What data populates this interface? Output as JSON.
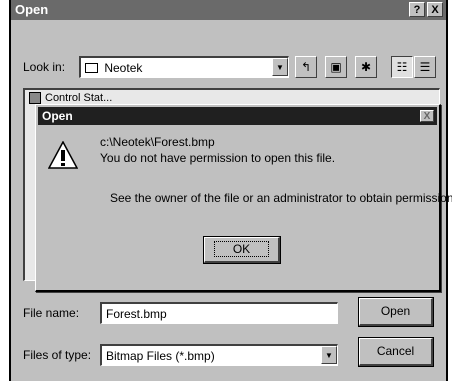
{
  "dialog": {
    "title": "Open",
    "help_label": "?",
    "close_label": "X",
    "look_in": {
      "label": "Look in:",
      "value": "Neotek"
    },
    "file_list": {
      "partial_item": "Control Stat..."
    },
    "file_name": {
      "label": "File name:",
      "value": "Forest.bmp"
    },
    "files_of_type": {
      "label": "Files of type:",
      "value": "Bitmap Files (*.bmp)"
    },
    "open_label": "Open",
    "cancel_label": "Cancel"
  },
  "message_box": {
    "title": "Open",
    "close_label": "X",
    "path": "c:\\Neotek\\Forest.bmp",
    "line1": "You do not have permission to open this file.",
    "line2": "See the owner of the file or an administrator to obtain permission.",
    "ok_label": "OK",
    "icon": "warning-icon"
  },
  "toolbar": {
    "icons": [
      "up-one-level-icon",
      "desktop-icon",
      "new-folder-icon",
      "list-view-icon",
      "details-view-icon"
    ]
  }
}
